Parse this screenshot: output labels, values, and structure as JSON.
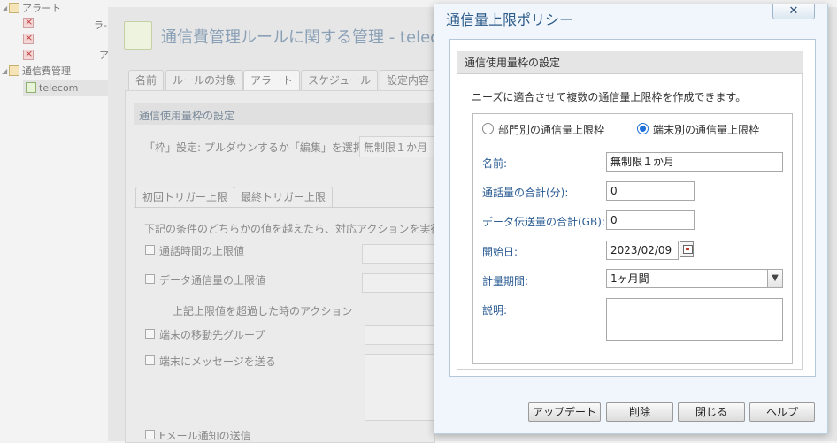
{
  "tree": {
    "alert_label": "アラート",
    "side_ra": "ラ-",
    "side_a": "ア",
    "cost_mgmt_label": "通信費管理",
    "telecom_label": "telecom"
  },
  "background": {
    "title": "通信費管理ルールに関する管理 - telecom",
    "tabs": [
      "名前",
      "ルールの対象",
      "アラート",
      "スケジュール",
      "設定内容"
    ],
    "section_title": "通信使用量枠の設定",
    "frame_prompt": "「枠」設定: プルダウンするか「編集」を選択:",
    "frame_value": "無制限１か月",
    "subtabs": [
      "初回トリガー上限",
      "最終トリガー上限"
    ],
    "condition_text": "下記の条件のどちらかの値を越えたら、対応アクションを実行.",
    "call_limit": "通話時間の上限値",
    "data_limit": "データ通信量の上限値",
    "action_heading": "上記上限値を超過した時のアクション",
    "move_group": "端末の移動先グループ",
    "send_message": "端末にメッセージを送る",
    "email": "Eメール通知の送信"
  },
  "dialog": {
    "title": "通信量上限ポリシー",
    "close_glyph": "✕",
    "section_title": "通信使用量枠の設定",
    "description": "ニーズに適合させて複数の通信量上限枠を作成できます。",
    "radio_department": "部門別の通信量上限枠",
    "radio_device": "端末別の通信量上限枠",
    "name_label": "名前:",
    "name_value": "無制限１か月",
    "call_total_label": "通話量の合計(分):",
    "call_total_value": "0",
    "data_total_label": "データ伝送量の合計(GB):",
    "data_total_value": "0",
    "start_label": "開始日:",
    "start_value": "2023/02/09",
    "period_label": "計量期間:",
    "period_value": "1ヶ月間",
    "desc_label": "説明:",
    "desc_value": "",
    "buttons": {
      "update": "アップデート",
      "delete": "削除",
      "close": "閉じる",
      "help": "ヘルプ"
    }
  },
  "colors": {
    "accent": "#2b5c93",
    "radio_selected": "#1e6fd9",
    "dialog_bg": "#f0f6fb"
  }
}
